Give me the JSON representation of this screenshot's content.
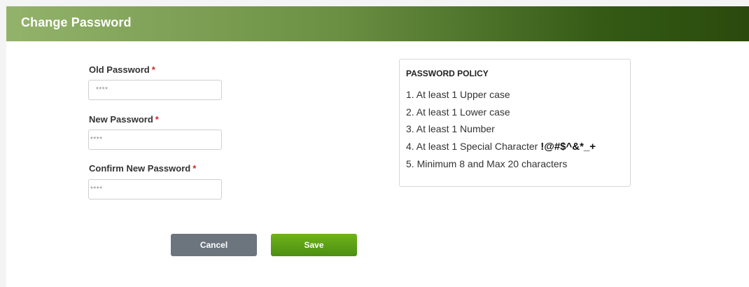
{
  "header": {
    "title": "Change Password"
  },
  "form": {
    "required_marker": "*",
    "old_password": {
      "label": "Old Password",
      "placeholder": "****"
    },
    "new_password": {
      "label": "New Password",
      "placeholder": "****"
    },
    "confirm_password": {
      "label": "Confirm New Password",
      "placeholder": "****"
    }
  },
  "policy": {
    "title": "PASSWORD POLICY",
    "items": [
      "1. At least 1 Upper case",
      "2. At least 1 Lower case",
      "3. At least 1 Number",
      "4. At least 1 Special Character",
      "5. Minimum 8 and Max 20 characters"
    ],
    "special_characters": "!@#$^&*_+"
  },
  "buttons": {
    "cancel_label": "Cancel",
    "save_label": "Save"
  },
  "colors": {
    "header_gradient_start": "#93b36b",
    "header_gradient_end": "#2a4a0d",
    "required_marker": "#d9232a",
    "cancel_button": "#6c757d",
    "save_button": "#5ea416"
  }
}
